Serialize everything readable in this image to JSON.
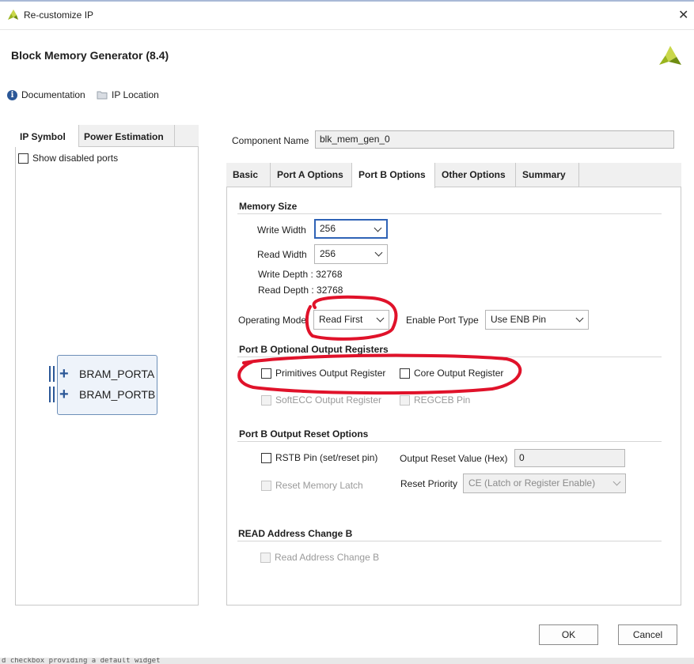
{
  "window": {
    "title": "Re-customize IP"
  },
  "header": {
    "title": "Block Memory Generator (8.4)"
  },
  "toolbar": {
    "documentation": "Documentation",
    "ip_location": "IP Location"
  },
  "left_panel": {
    "tabs": [
      "IP Symbol",
      "Power Estimation"
    ],
    "show_disabled_ports": "Show disabled ports",
    "ports": [
      "BRAM_PORTA",
      "BRAM_PORTB"
    ]
  },
  "component": {
    "label": "Component Name",
    "value": "blk_mem_gen_0"
  },
  "tabs": [
    "Basic",
    "Port A Options",
    "Port B Options",
    "Other Options",
    "Summary"
  ],
  "memory_size": {
    "heading": "Memory Size",
    "write_width_label": "Write Width",
    "write_width_value": "256",
    "read_width_label": "Read Width",
    "read_width_value": "256",
    "write_depth": "Write Depth : 32768",
    "read_depth": "Read Depth : 32768"
  },
  "operating_mode": {
    "label": "Operating Mode",
    "value": "Read First"
  },
  "enable_port": {
    "label": "Enable Port Type",
    "value": "Use ENB Pin"
  },
  "output_registers": {
    "heading": "Port B Optional Output Registers",
    "primitives": "Primitives Output Register",
    "core": "Core Output Register",
    "softecc": "SoftECC Output Register",
    "regceb": "REGCEB Pin"
  },
  "reset_options": {
    "heading": "Port B Output Reset Options",
    "rstb": "RSTB Pin (set/reset pin)",
    "output_reset_label": "Output Reset Value (Hex)",
    "output_reset_value": "0",
    "reset_memory_latch": "Reset Memory Latch",
    "reset_priority_label": "Reset Priority",
    "reset_priority_value": "CE (Latch or Register Enable)"
  },
  "read_address": {
    "heading": "READ Address Change B",
    "checkbox": "Read Address Change B"
  },
  "buttons": {
    "ok": "OK",
    "cancel": "Cancel"
  },
  "statusbar": {
    "text": "d checkbox providing a default widget"
  },
  "colors": {
    "annotation": "#e0122a",
    "accent": "#2f63b6",
    "brand": "#9ab51e"
  }
}
